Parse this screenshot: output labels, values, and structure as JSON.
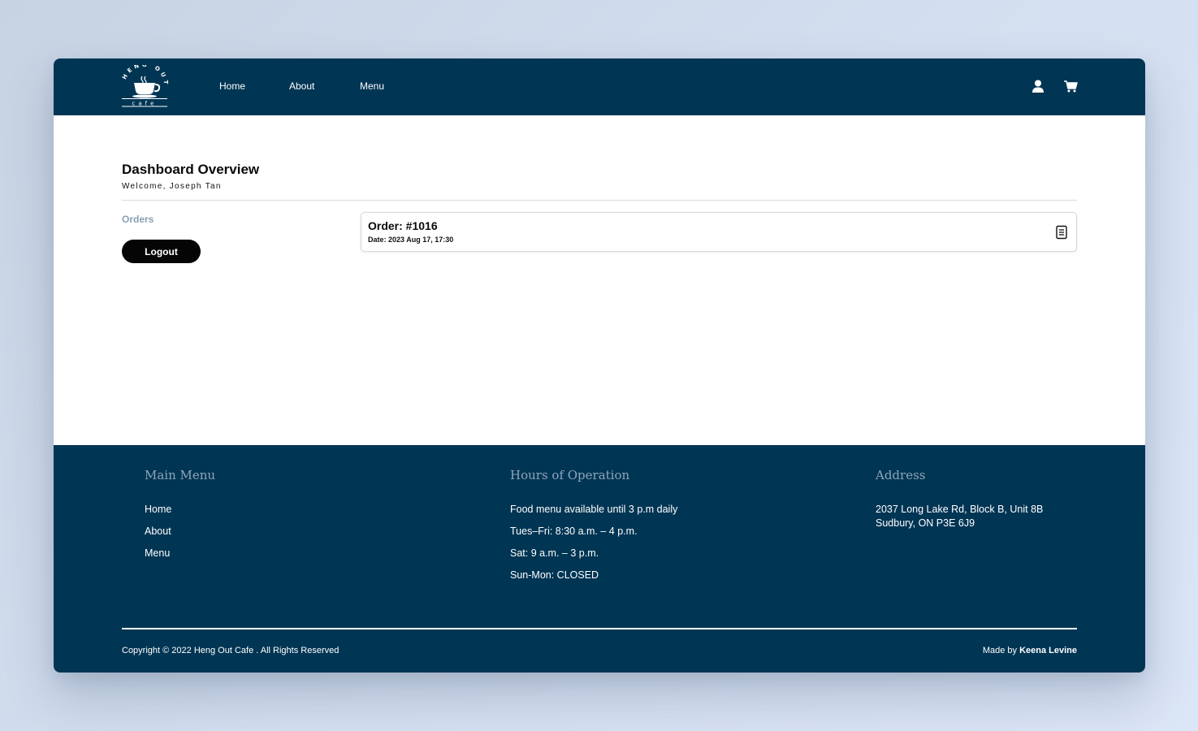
{
  "nav": {
    "logo_top_text": "HENG OUT",
    "logo_bottom_text": "cafe",
    "links": [
      "Home",
      "About",
      "Menu"
    ]
  },
  "dashboard": {
    "title": "Dashboard Overview",
    "welcome": "Welcome, Joseph Tan",
    "sidebar": {
      "orders_label": "Orders",
      "logout_label": "Logout"
    },
    "orders": [
      {
        "title": "Order: #1016",
        "date": "Date: 2023 Aug 17, 17:30"
      }
    ]
  },
  "footer": {
    "main_menu": {
      "heading": "Main Menu",
      "links": [
        "Home",
        "About",
        "Menu"
      ]
    },
    "hours": {
      "heading": "Hours of Operation",
      "lines": [
        "Food menu available until 3 p.m daily",
        "Tues–Fri: 8:30 a.m. – 4 p.m.",
        "Sat: 9 a.m. – 3 p.m.",
        "Sun-Mon: CLOSED"
      ]
    },
    "address": {
      "heading": "Address",
      "line1": "2037 Long Lake Rd, Block B, Unit 8B",
      "line2": "Sudbury, ON P3E 6J9"
    },
    "copyright": "Copyright © 2022 Heng Out Cafe . All Rights Reserved",
    "made_by_prefix": "Made by",
    "made_by_name": "Keena Levine"
  },
  "colors": {
    "navy": "#003554",
    "muted_heading": "#8fa6ba",
    "orders_link": "#8a9fb2",
    "button_black": "#050505"
  },
  "icons": {
    "user": "user-icon",
    "cart": "cart-icon",
    "receipt": "receipt-icon",
    "logo": "coffee-cup-logo"
  }
}
